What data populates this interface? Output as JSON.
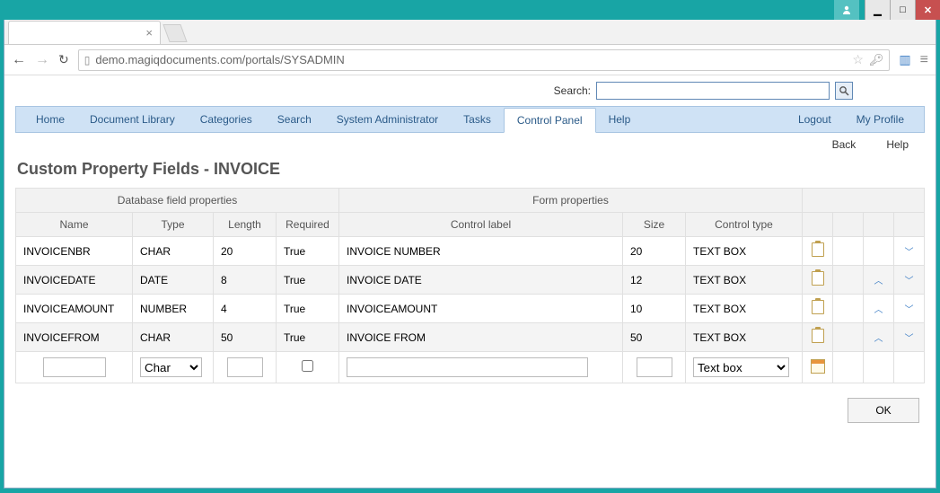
{
  "window": {
    "user": "▲",
    "min": "—",
    "max": "▢",
    "close": "✕"
  },
  "browser": {
    "tab_close": "×",
    "url": "demo.magiqdocuments.com/portals/SYSADMIN"
  },
  "search": {
    "label": "Search:",
    "value": ""
  },
  "menu": {
    "home": "Home",
    "doclib": "Document Library",
    "categories": "Categories",
    "search": "Search",
    "sysadmin": "System Administrator",
    "tasks": "Tasks",
    "control_panel": "Control Panel",
    "help": "Help",
    "logout": "Logout",
    "myprofile": "My Profile"
  },
  "sublinks": {
    "back": "Back",
    "help": "Help"
  },
  "page_title": "Custom Property Fields - INVOICE",
  "grid": {
    "group1": "Database field properties",
    "group2": "Form properties",
    "headers": {
      "name": "Name",
      "type": "Type",
      "length": "Length",
      "required": "Required",
      "control_label": "Control label",
      "size": "Size",
      "control_type": "Control type"
    },
    "rows": [
      {
        "name": "INVOICENBR",
        "type": "CHAR",
        "length": "20",
        "required": "True",
        "label": "INVOICE NUMBER",
        "size": "20",
        "ctype": "TEXT BOX",
        "up": false,
        "down": true
      },
      {
        "name": "INVOICEDATE",
        "type": "DATE",
        "length": "8",
        "required": "True",
        "label": "INVOICE DATE",
        "size": "12",
        "ctype": "TEXT BOX",
        "up": true,
        "down": true
      },
      {
        "name": "INVOICEAMOUNT",
        "type": "NUMBER",
        "length": "4",
        "required": "True",
        "label": "INVOICEAMOUNT",
        "size": "10",
        "ctype": "TEXT BOX",
        "up": true,
        "down": true
      },
      {
        "name": "INVOICEFROM",
        "type": "CHAR",
        "length": "50",
        "required": "True",
        "label": "INVOICE FROM",
        "size": "50",
        "ctype": "TEXT BOX",
        "up": true,
        "down": true
      }
    ],
    "new_row": {
      "type_options": [
        "Char"
      ],
      "type_selected": "Char",
      "ctype_options": [
        "Text box"
      ],
      "ctype_selected": "Text box"
    }
  },
  "ok_label": "OK"
}
